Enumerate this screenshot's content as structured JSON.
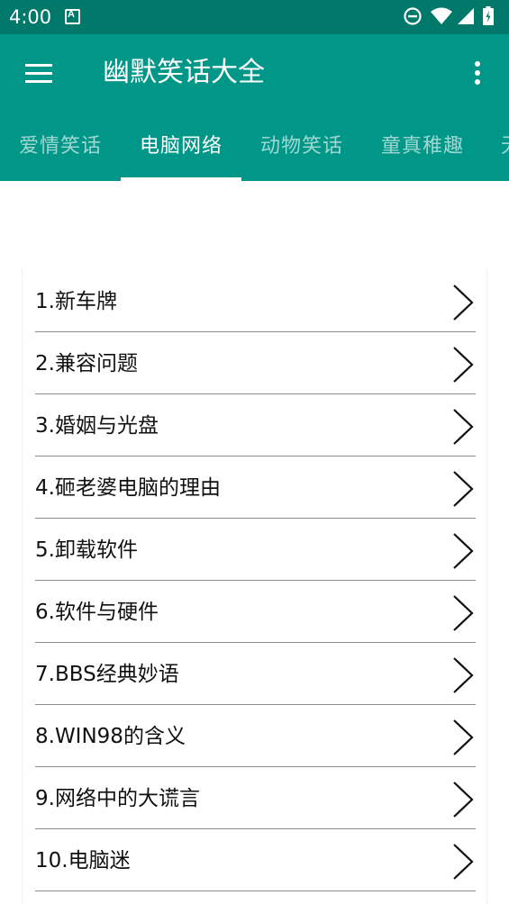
{
  "status_bar": {
    "time": "4:00",
    "notification_icon": "A",
    "icons": [
      "do-not-disturb-icon",
      "wifi-icon",
      "cell-signal-icon",
      "battery-icon"
    ]
  },
  "app_bar": {
    "title": "幽默笑话大全",
    "menu_icon": "hamburger-menu-icon",
    "overflow_icon": "more-vert-icon",
    "color": "#009688",
    "status_color": "#00796b"
  },
  "tabs": [
    {
      "label": "爱情笑话",
      "active": false
    },
    {
      "label": "电脑网络",
      "active": true
    },
    {
      "label": "动物笑话",
      "active": false
    },
    {
      "label": "童真稚趣",
      "active": false
    },
    {
      "label": "无",
      "active": false
    }
  ],
  "jokes": [
    {
      "label": "1.新车牌"
    },
    {
      "label": "2.兼容问题"
    },
    {
      "label": "3.婚姻与光盘"
    },
    {
      "label": "4.砸老婆电脑的理由"
    },
    {
      "label": "5.卸载软件"
    },
    {
      "label": "6.软件与硬件"
    },
    {
      "label": "7.BBS经典妙语"
    },
    {
      "label": "8.WIN98的含义"
    },
    {
      "label": "9.网络中的大谎言"
    },
    {
      "label": "10.电脑迷"
    }
  ]
}
